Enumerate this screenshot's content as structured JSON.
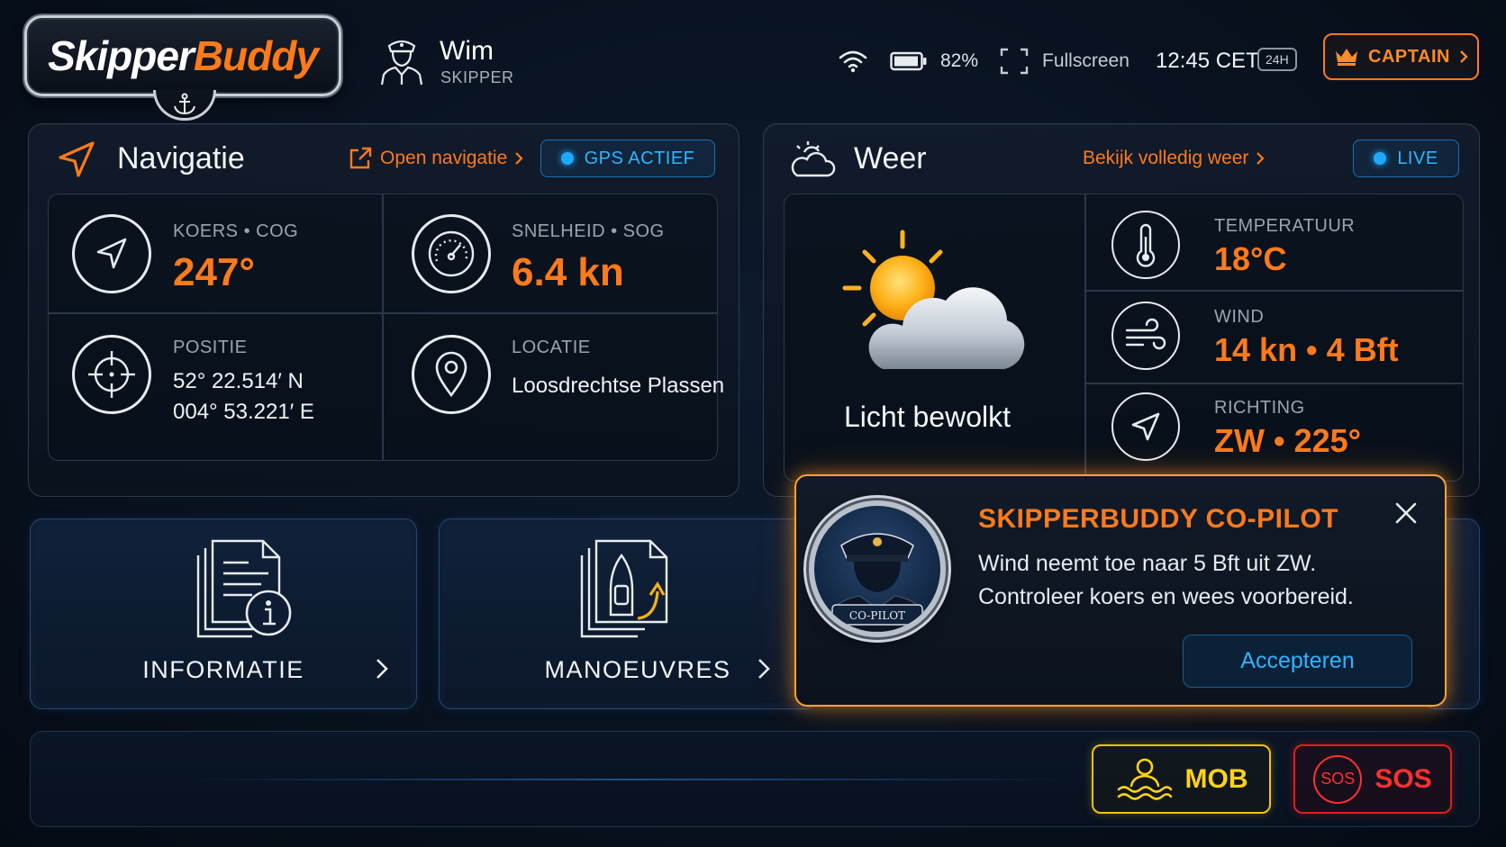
{
  "header": {
    "logo_part1": "Skipper",
    "logo_part2": "Buddy",
    "user_name": "Wim",
    "user_role": "SKIPPER",
    "battery_pct": "82%",
    "fullscreen_label": "Fullscreen",
    "clock": "12:45 CET",
    "clock_format": "24H",
    "captain_label": "CAPTAIN"
  },
  "navigation": {
    "title": "Navigatie",
    "open_link": "Open navigatie",
    "gps_status": "GPS ACTIEF",
    "course_label": "KOERS • COG",
    "course_value": "247°",
    "speed_label": "SNELHEID • SOG",
    "speed_value": "6.4 kn",
    "position_label": "POSITIE",
    "position_lat": "52° 22.514′ N",
    "position_lon": "004° 53.221′ E",
    "location_label": "LOCATIE",
    "location_value": "Loosdrechtse Plassen"
  },
  "weather": {
    "title": "Weer",
    "full_link": "Bekijk volledig weer",
    "live_label": "LIVE",
    "condition": "Licht bewolkt",
    "temp_label": "TEMPERATUUR",
    "temp_value": "18°C",
    "wind_label": "WIND",
    "wind_value": "14 kn • 4 Bft",
    "direction_label": "RICHTING",
    "direction_value": "ZW • 225°"
  },
  "tiles": {
    "info_label": "INFORMATIE",
    "manoeuvres_label": "MANOEUVRES"
  },
  "copilot": {
    "badge_text": "CO-PILOT",
    "title": "SKIPPERBUDDY CO-PILOT",
    "message": "Wind neemt toe naar 5 Bft uit ZW. Controleer koers en wees voorbereid.",
    "accept_label": "Accepteren"
  },
  "emergency": {
    "mob_label": "MOB",
    "sos_ring": "SOS",
    "sos_label": "SOS"
  },
  "colors": {
    "accent_orange": "#ff7a1a",
    "accent_blue": "#2eb6ff",
    "mob_yellow": "#ffd21a",
    "sos_red": "#ff3030"
  }
}
